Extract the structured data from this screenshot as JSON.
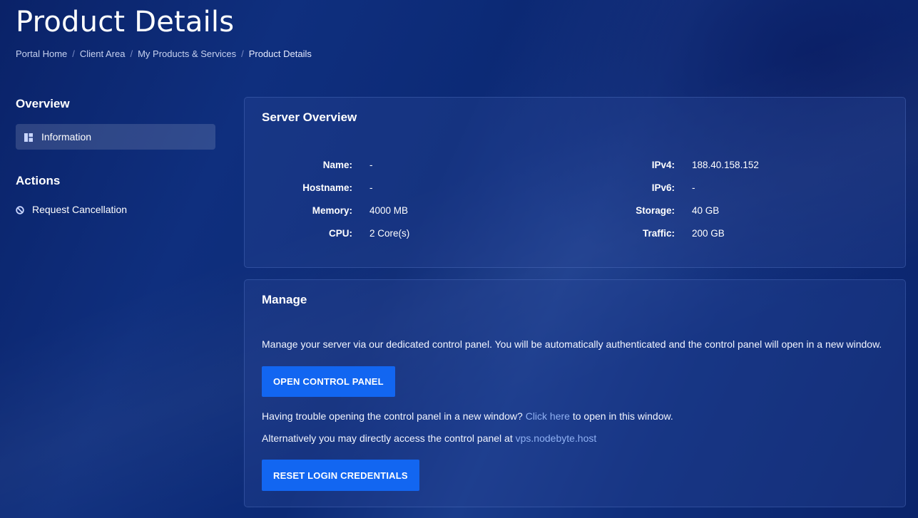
{
  "page": {
    "title": "Product Details"
  },
  "breadcrumb": [
    {
      "label": "Portal Home"
    },
    {
      "label": "Client Area"
    },
    {
      "label": "My Products & Services"
    },
    {
      "label": "Product Details"
    }
  ],
  "sidebar": {
    "overview_heading": "Overview",
    "overview_items": [
      {
        "label": "Information",
        "icon": "dashboard-icon"
      }
    ],
    "actions_heading": "Actions",
    "action_items": [
      {
        "label": "Request Cancellation",
        "icon": "ban-icon"
      }
    ]
  },
  "overview": {
    "title": "Server Overview",
    "left": [
      {
        "label": "Name:",
        "value": "-"
      },
      {
        "label": "Hostname:",
        "value": "-"
      },
      {
        "label": "Memory:",
        "value": "4000 MB"
      },
      {
        "label": "CPU:",
        "value": "2 Core(s)"
      }
    ],
    "right": [
      {
        "label": "IPv4:",
        "value": "188.40.158.152"
      },
      {
        "label": "IPv6:",
        "value": "-"
      },
      {
        "label": "Storage:",
        "value": "40 GB"
      },
      {
        "label": "Traffic:",
        "value": "200 GB"
      }
    ]
  },
  "manage": {
    "title": "Manage",
    "intro": "Manage your server via our dedicated control panel. You will be automatically authenticated and the control panel will open in a new window.",
    "open_button": "OPEN CONTROL PANEL",
    "trouble_prefix": "Having trouble opening the control panel in a new window?",
    "trouble_link": "Click here",
    "trouble_suffix": "to open in this window.",
    "alt_prefix": "Alternatively you may directly access the control panel at",
    "alt_link": "vps.nodebyte.host",
    "reset_button": "RESET LOGIN CREDENTIALS"
  },
  "colors": {
    "accent": "#1266f1",
    "link": "#8fb0f2",
    "background": "#0b2468"
  }
}
